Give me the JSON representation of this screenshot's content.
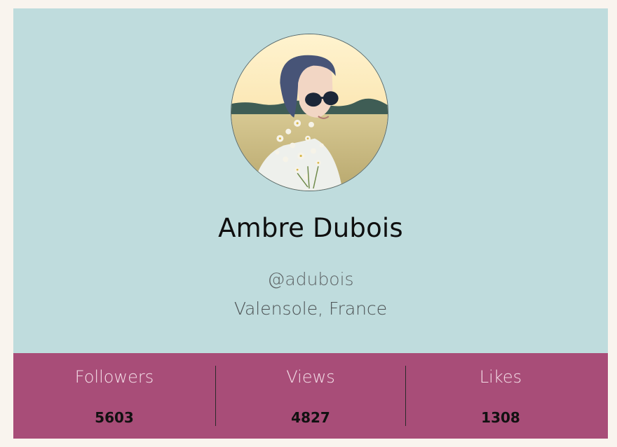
{
  "profile": {
    "name": "Ambre Dubois",
    "handle": "@adubois",
    "location": "Valensole, France",
    "avatar_icon": "profile-photo"
  },
  "stats": [
    {
      "label": "Followers",
      "value": "5603"
    },
    {
      "label": "Views",
      "value": "4827"
    },
    {
      "label": "Likes",
      "value": "1308"
    }
  ],
  "colors": {
    "page_bg": "#f9f4ee",
    "card_bg": "#bfdcdd",
    "stats_bg": "#a84d78",
    "stat_label": "#f3dde7"
  }
}
